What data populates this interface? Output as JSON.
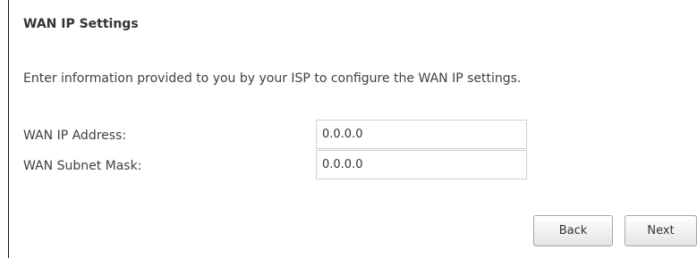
{
  "section": {
    "title": "WAN IP Settings",
    "description": "Enter information provided to you by your ISP to configure the WAN IP settings."
  },
  "form": {
    "wan_ip": {
      "label": "WAN IP Address:",
      "value": "0.0.0.0"
    },
    "subnet_mask": {
      "label": "WAN Subnet Mask:",
      "value": "0.0.0.0"
    }
  },
  "buttons": {
    "back": "Back",
    "next": "Next"
  }
}
